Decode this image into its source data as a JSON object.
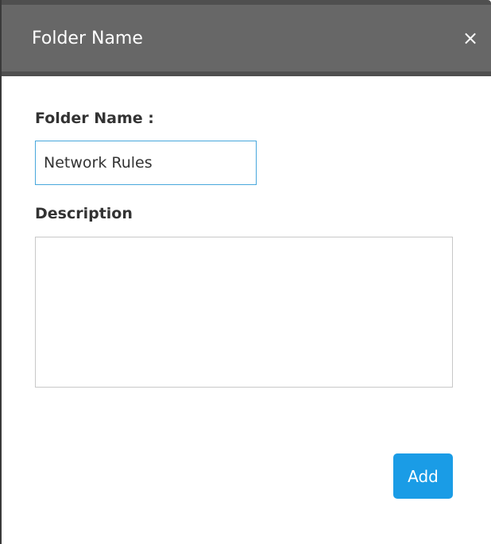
{
  "dialog": {
    "title": "Folder Name",
    "close_label": "×"
  },
  "form": {
    "folder_name_label": "Folder Name :",
    "folder_name_value": "Network Rules",
    "description_label": "Description",
    "description_value": ""
  },
  "actions": {
    "add_label": "Add"
  },
  "colors": {
    "titlebar": "#676767",
    "accent": "#1a9ce6",
    "input_focus_border": "#48a7dc"
  }
}
